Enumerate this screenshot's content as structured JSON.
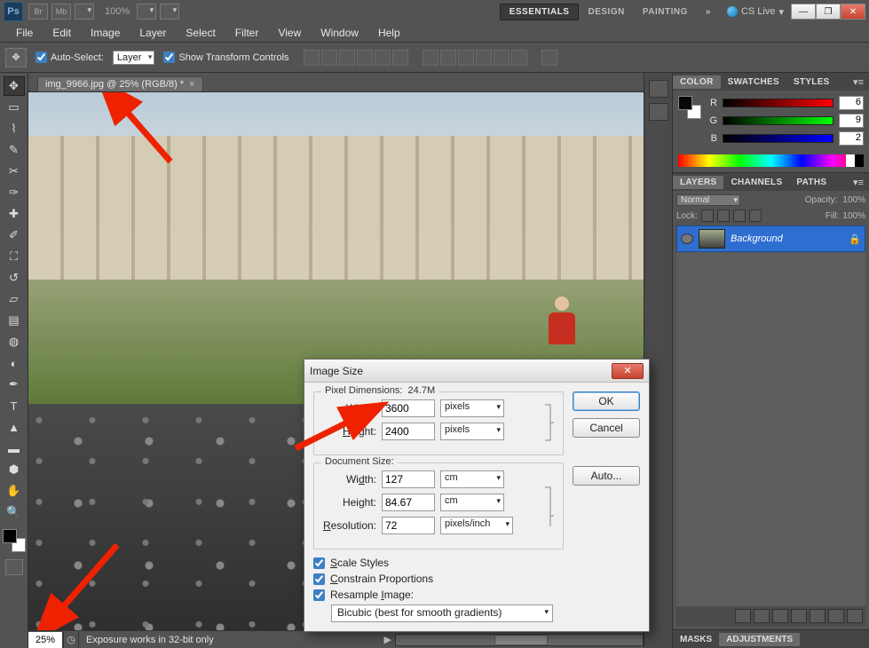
{
  "app": {
    "name": "Ps"
  },
  "titlebar": {
    "br": "Br",
    "mb": "Mb",
    "zoom": "100%",
    "workspaces": {
      "essentials": "ESSENTIALS",
      "design": "DESIGN",
      "painting": "PAINTING",
      "more": "»"
    },
    "cslive": "CS Live"
  },
  "menu": {
    "file": "File",
    "edit": "Edit",
    "image": "Image",
    "layer": "Layer",
    "select": "Select",
    "filter": "Filter",
    "view": "View",
    "window": "Window",
    "help": "Help"
  },
  "options": {
    "autoSelect": "Auto-Select:",
    "autoSelectTarget": "Layer",
    "showTransform": "Show Transform Controls"
  },
  "document": {
    "tab": "img_9966.jpg @ 25% (RGB/8) *",
    "status_zoom": "25%",
    "status_info": "Exposure works in 32-bit only"
  },
  "panels": {
    "color": {
      "tab_color": "COLOR",
      "tab_swatches": "SWATCHES",
      "tab_styles": "STYLES",
      "r": "R",
      "g": "G",
      "b": "B",
      "r_val": "6",
      "g_val": "9",
      "b_val": "2"
    },
    "layers": {
      "tab_layers": "LAYERS",
      "tab_channels": "CHANNELS",
      "tab_paths": "PATHS",
      "blend": "Normal",
      "opacity_label": "Opacity:",
      "opacity_val": "100%",
      "lock": "Lock:",
      "fill_label": "Fill:",
      "fill_val": "100%",
      "bg_layer": "Background"
    },
    "bottom": {
      "masks": "MASKS",
      "adjustments": "ADJUSTMENTS"
    }
  },
  "dialog": {
    "title": "Image Size",
    "pixel_dim_label": "Pixel Dimensions:",
    "pixel_dim_size": "24.7M",
    "width_label": "Width:",
    "height_label": "Height:",
    "resolution_label": "Resolution:",
    "px_width": "3600",
    "px_height": "2400",
    "px_unit": "pixels",
    "doc_size_label": "Document Size:",
    "doc_width": "127",
    "doc_height": "84.67",
    "doc_unit": "cm",
    "res_val": "72",
    "res_unit": "pixels/inch",
    "scale_styles": "Scale Styles",
    "constrain": "Constrain Proportions",
    "resample": "Resample Image:",
    "resample_method": "Bicubic (best for smooth gradients)",
    "ok": "OK",
    "cancel": "Cancel",
    "auto": "Auto..."
  }
}
